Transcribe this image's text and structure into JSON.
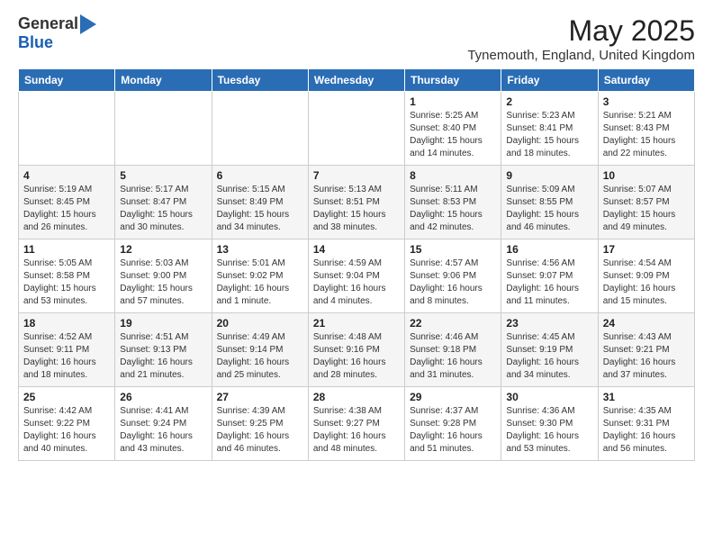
{
  "header": {
    "logo_general": "General",
    "logo_blue": "Blue",
    "month_title": "May 2025",
    "location": "Tynemouth, England, United Kingdom"
  },
  "days_of_week": [
    "Sunday",
    "Monday",
    "Tuesday",
    "Wednesday",
    "Thursday",
    "Friday",
    "Saturday"
  ],
  "weeks": [
    [
      {
        "day": "",
        "info": ""
      },
      {
        "day": "",
        "info": ""
      },
      {
        "day": "",
        "info": ""
      },
      {
        "day": "",
        "info": ""
      },
      {
        "day": "1",
        "info": "Sunrise: 5:25 AM\nSunset: 8:40 PM\nDaylight: 15 hours\nand 14 minutes."
      },
      {
        "day": "2",
        "info": "Sunrise: 5:23 AM\nSunset: 8:41 PM\nDaylight: 15 hours\nand 18 minutes."
      },
      {
        "day": "3",
        "info": "Sunrise: 5:21 AM\nSunset: 8:43 PM\nDaylight: 15 hours\nand 22 minutes."
      }
    ],
    [
      {
        "day": "4",
        "info": "Sunrise: 5:19 AM\nSunset: 8:45 PM\nDaylight: 15 hours\nand 26 minutes."
      },
      {
        "day": "5",
        "info": "Sunrise: 5:17 AM\nSunset: 8:47 PM\nDaylight: 15 hours\nand 30 minutes."
      },
      {
        "day": "6",
        "info": "Sunrise: 5:15 AM\nSunset: 8:49 PM\nDaylight: 15 hours\nand 34 minutes."
      },
      {
        "day": "7",
        "info": "Sunrise: 5:13 AM\nSunset: 8:51 PM\nDaylight: 15 hours\nand 38 minutes."
      },
      {
        "day": "8",
        "info": "Sunrise: 5:11 AM\nSunset: 8:53 PM\nDaylight: 15 hours\nand 42 minutes."
      },
      {
        "day": "9",
        "info": "Sunrise: 5:09 AM\nSunset: 8:55 PM\nDaylight: 15 hours\nand 46 minutes."
      },
      {
        "day": "10",
        "info": "Sunrise: 5:07 AM\nSunset: 8:57 PM\nDaylight: 15 hours\nand 49 minutes."
      }
    ],
    [
      {
        "day": "11",
        "info": "Sunrise: 5:05 AM\nSunset: 8:58 PM\nDaylight: 15 hours\nand 53 minutes."
      },
      {
        "day": "12",
        "info": "Sunrise: 5:03 AM\nSunset: 9:00 PM\nDaylight: 15 hours\nand 57 minutes."
      },
      {
        "day": "13",
        "info": "Sunrise: 5:01 AM\nSunset: 9:02 PM\nDaylight: 16 hours\nand 1 minute."
      },
      {
        "day": "14",
        "info": "Sunrise: 4:59 AM\nSunset: 9:04 PM\nDaylight: 16 hours\nand 4 minutes."
      },
      {
        "day": "15",
        "info": "Sunrise: 4:57 AM\nSunset: 9:06 PM\nDaylight: 16 hours\nand 8 minutes."
      },
      {
        "day": "16",
        "info": "Sunrise: 4:56 AM\nSunset: 9:07 PM\nDaylight: 16 hours\nand 11 minutes."
      },
      {
        "day": "17",
        "info": "Sunrise: 4:54 AM\nSunset: 9:09 PM\nDaylight: 16 hours\nand 15 minutes."
      }
    ],
    [
      {
        "day": "18",
        "info": "Sunrise: 4:52 AM\nSunset: 9:11 PM\nDaylight: 16 hours\nand 18 minutes."
      },
      {
        "day": "19",
        "info": "Sunrise: 4:51 AM\nSunset: 9:13 PM\nDaylight: 16 hours\nand 21 minutes."
      },
      {
        "day": "20",
        "info": "Sunrise: 4:49 AM\nSunset: 9:14 PM\nDaylight: 16 hours\nand 25 minutes."
      },
      {
        "day": "21",
        "info": "Sunrise: 4:48 AM\nSunset: 9:16 PM\nDaylight: 16 hours\nand 28 minutes."
      },
      {
        "day": "22",
        "info": "Sunrise: 4:46 AM\nSunset: 9:18 PM\nDaylight: 16 hours\nand 31 minutes."
      },
      {
        "day": "23",
        "info": "Sunrise: 4:45 AM\nSunset: 9:19 PM\nDaylight: 16 hours\nand 34 minutes."
      },
      {
        "day": "24",
        "info": "Sunrise: 4:43 AM\nSunset: 9:21 PM\nDaylight: 16 hours\nand 37 minutes."
      }
    ],
    [
      {
        "day": "25",
        "info": "Sunrise: 4:42 AM\nSunset: 9:22 PM\nDaylight: 16 hours\nand 40 minutes."
      },
      {
        "day": "26",
        "info": "Sunrise: 4:41 AM\nSunset: 9:24 PM\nDaylight: 16 hours\nand 43 minutes."
      },
      {
        "day": "27",
        "info": "Sunrise: 4:39 AM\nSunset: 9:25 PM\nDaylight: 16 hours\nand 46 minutes."
      },
      {
        "day": "28",
        "info": "Sunrise: 4:38 AM\nSunset: 9:27 PM\nDaylight: 16 hours\nand 48 minutes."
      },
      {
        "day": "29",
        "info": "Sunrise: 4:37 AM\nSunset: 9:28 PM\nDaylight: 16 hours\nand 51 minutes."
      },
      {
        "day": "30",
        "info": "Sunrise: 4:36 AM\nSunset: 9:30 PM\nDaylight: 16 hours\nand 53 minutes."
      },
      {
        "day": "31",
        "info": "Sunrise: 4:35 AM\nSunset: 9:31 PM\nDaylight: 16 hours\nand 56 minutes."
      }
    ]
  ]
}
